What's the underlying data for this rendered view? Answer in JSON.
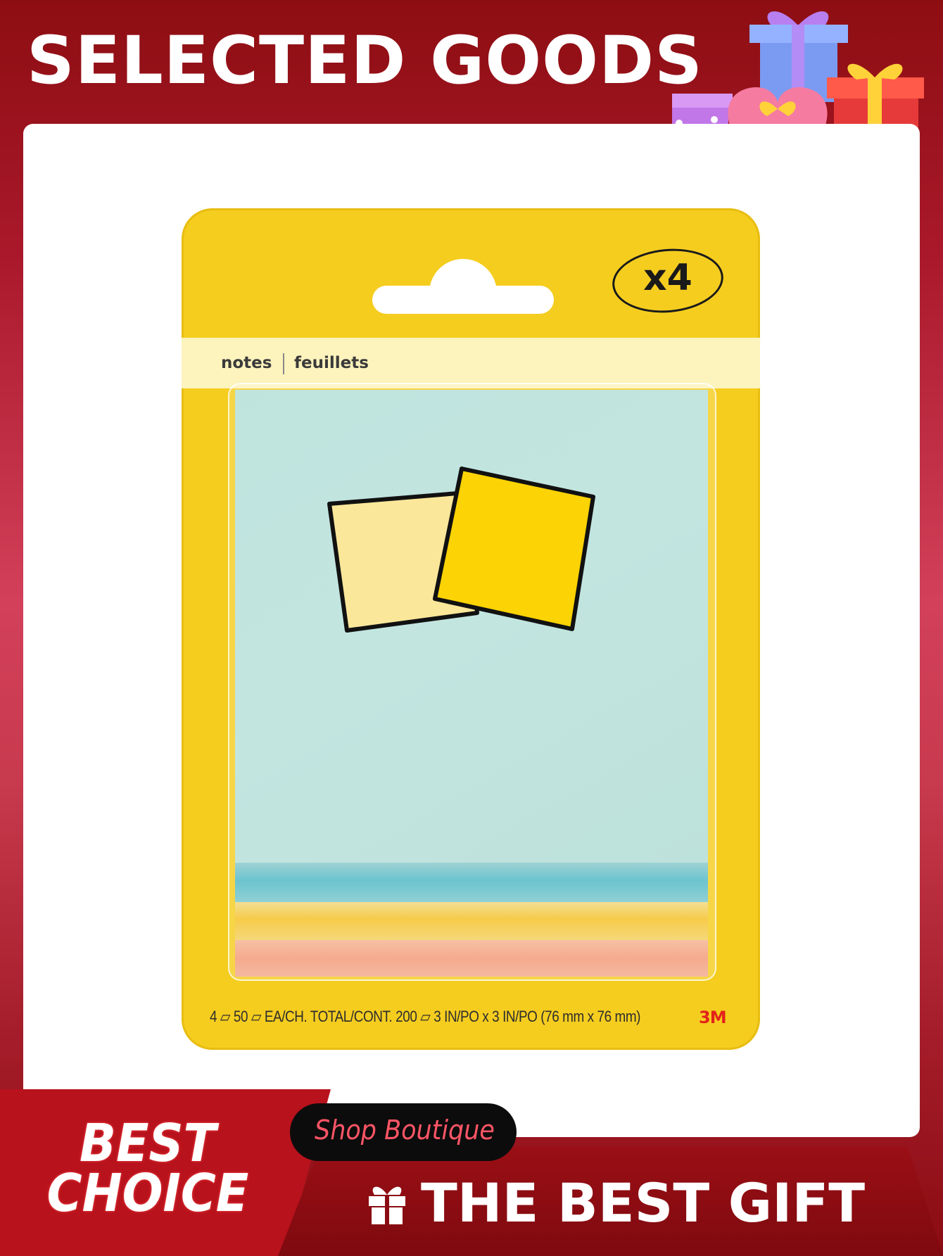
{
  "header": {
    "title": "SELECTED GOODS"
  },
  "product": {
    "quantity_badge": "x4",
    "label_en": "notes",
    "label_fr": "feuillets",
    "spec_text": "4 ▱ 50 ▱ EA/CH. TOTAL/CONT. 200 ▱ 3 IN/PO x 3 IN/PO (76 mm x 76 mm)",
    "brand": "3M",
    "pad_colors": [
      "#c3e5e0",
      "#6cc4cf",
      "#f7cb4a",
      "#f5aa8e"
    ]
  },
  "banner": {
    "best_choice": "BEST CHOICE",
    "shop_label": "Shop Boutique",
    "gift_label": "THE BEST GIFT",
    "gift_icon": "gift-icon"
  },
  "decor": {
    "gift_boxes": "gift-boxes-illustration"
  }
}
